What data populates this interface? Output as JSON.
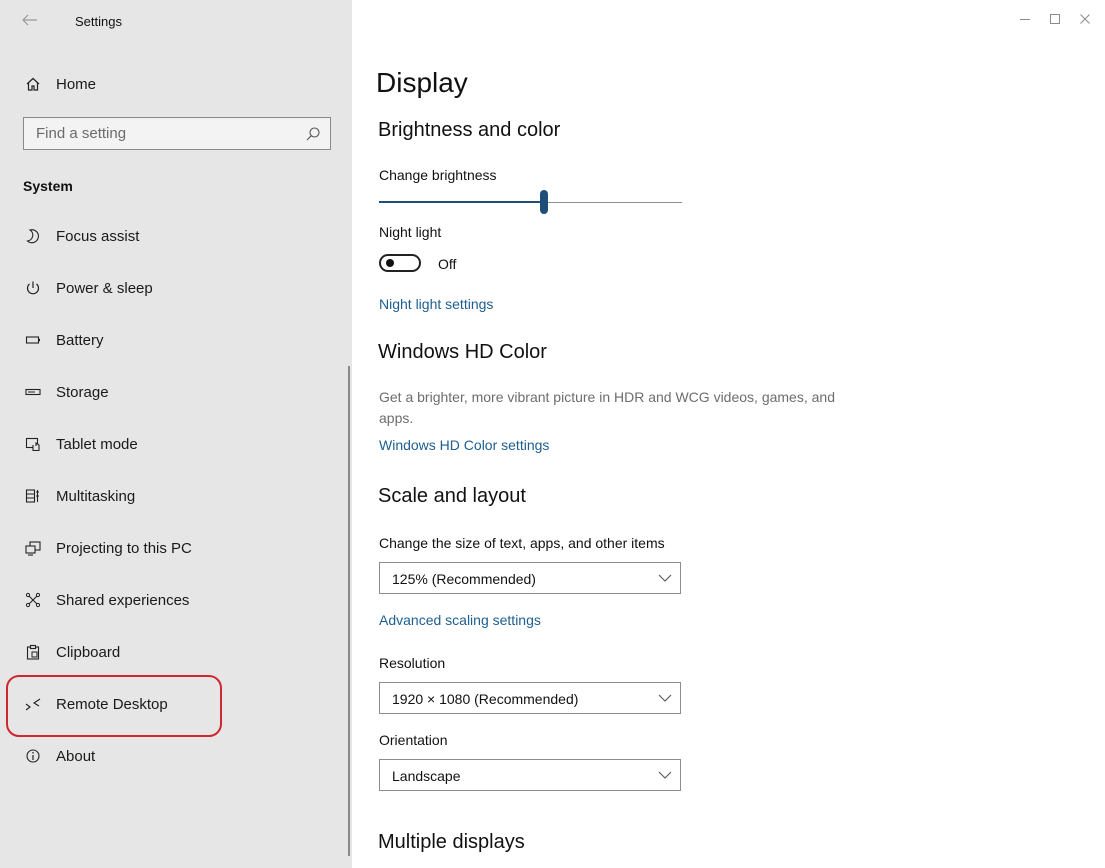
{
  "titlebar": {
    "back_icon": "back-arrow-icon",
    "app_title": "Settings",
    "controls": {
      "minimize": "—",
      "maximize": "☐",
      "close": "✕"
    }
  },
  "sidebar": {
    "home_label": "Home",
    "search_placeholder": "Find a setting",
    "section_title": "System",
    "items": [
      {
        "label": "Focus assist",
        "icon": "moon-icon"
      },
      {
        "label": "Power & sleep",
        "icon": "power-icon"
      },
      {
        "label": "Battery",
        "icon": "battery-icon"
      },
      {
        "label": "Storage",
        "icon": "storage-icon"
      },
      {
        "label": "Tablet mode",
        "icon": "tablet-mode-icon"
      },
      {
        "label": "Multitasking",
        "icon": "multitasking-icon"
      },
      {
        "label": "Projecting to this PC",
        "icon": "projecting-icon"
      },
      {
        "label": "Shared experiences",
        "icon": "shared-experiences-icon"
      },
      {
        "label": "Clipboard",
        "icon": "clipboard-icon"
      },
      {
        "label": "Remote Desktop",
        "icon": "remote-desktop-icon"
      },
      {
        "label": "About",
        "icon": "info-icon"
      }
    ],
    "highlight_color": "#d0262e"
  },
  "main": {
    "page_title": "Display",
    "brightness": {
      "heading": "Brightness and color",
      "slider_label": "Change brightness",
      "brightness_level": 0.55
    },
    "night_light": {
      "label": "Night light",
      "state": "Off",
      "settings_link": "Night light settings"
    },
    "hd_color": {
      "heading": "Windows HD Color",
      "description": "Get a brighter, more vibrant picture in HDR and WCG videos, games, and apps.",
      "settings_link": "Windows HD Color settings"
    },
    "scale_layout": {
      "heading": "Scale and layout",
      "size_label": "Change the size of text, apps, and other items",
      "size_value": "125% (Recommended)",
      "advanced_link": "Advanced scaling settings",
      "resolution_label": "Resolution",
      "resolution_value": "1920 × 1080 (Recommended)",
      "orientation_label": "Orientation",
      "orientation_value": "Landscape"
    },
    "multiple_displays": {
      "heading": "Multiple displays"
    }
  },
  "colors": {
    "link": "#1d5e91",
    "accent": "#1e4d78",
    "sidebar_bg": "#e6e6e6"
  }
}
